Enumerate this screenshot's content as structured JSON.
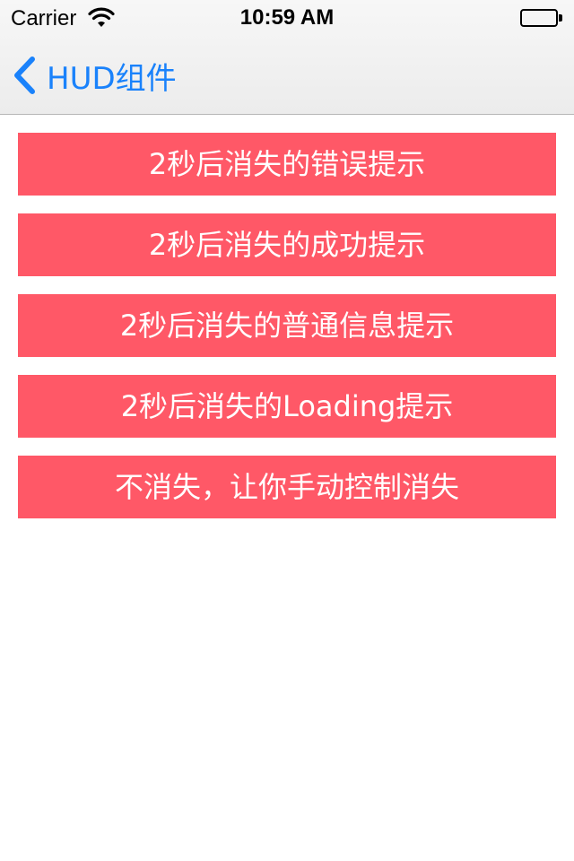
{
  "status_bar": {
    "carrier": "Carrier",
    "time": "10:59 AM",
    "wifi_icon": "wifi-icon",
    "battery_icon": "battery-icon"
  },
  "nav": {
    "back_label": "HUD组件",
    "back_icon": "chevron-left-icon",
    "accent": "#1a82fb"
  },
  "buttons": [
    {
      "label": "2秒后消失的错误提示"
    },
    {
      "label": "2秒后消失的成功提示"
    },
    {
      "label": "2秒后消失的普通信息提示"
    },
    {
      "label": "2秒后消失的Loading提示"
    },
    {
      "label": "不消失，让你手动控制消失"
    }
  ],
  "colors": {
    "button_bg": "#ff5867",
    "button_text": "#ffffff"
  }
}
